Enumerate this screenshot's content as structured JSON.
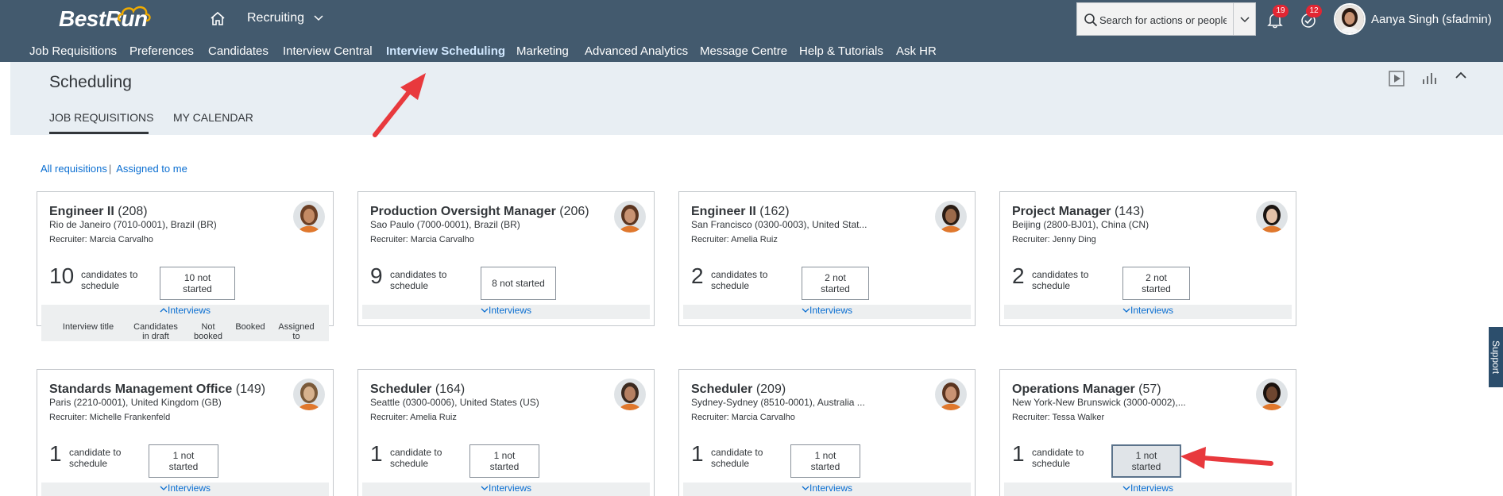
{
  "shell": {
    "logo": "BestRun",
    "module": "Recruiting",
    "search_placeholder": "Search for actions or people",
    "notifications_count": "19",
    "tasks_count": "12",
    "user_name": "Aanya Singh (sfadmin)"
  },
  "nav": [
    "Job Requisitions",
    "Preferences",
    "Candidates",
    "Interview Central",
    "Interview Scheduling",
    "Marketing",
    "Advanced Analytics",
    "Message Centre",
    "Help & Tutorials",
    "Ask HR"
  ],
  "nav_active": "Interview Scheduling",
  "page": {
    "title": "Scheduling",
    "tabs": [
      "JOB REQUISITIONS",
      "MY CALENDAR"
    ],
    "active_tab": "JOB REQUISITIONS"
  },
  "filters": {
    "all": "All requisitions",
    "sep": "|",
    "mine": "Assigned to me"
  },
  "cards": [
    {
      "title": "Engineer II",
      "id": "(208)",
      "location": "Rio de Janeiro (7010-0001), Brazil (BR)",
      "recruiter": "Recruiter: Marcia Carvalho",
      "count": "10",
      "count_label": "candidates to schedule",
      "status": "10 not started",
      "footer": "Interviews",
      "expanded": true,
      "columns": [
        "Interview title",
        "Candidates in draft",
        "Not booked",
        "Booked",
        "Assigned to"
      ]
    },
    {
      "title": "Production Oversight Manager",
      "id": "(206)",
      "location": "Sao Paulo (7000-0001), Brazil (BR)",
      "recruiter": "Recruiter: Marcia Carvalho",
      "count": "9",
      "count_label": "candidates to schedule",
      "status": "8 not started",
      "footer": "Interviews"
    },
    {
      "title": "Engineer II",
      "id": "(162)",
      "location": "San Francisco (0300-0003), United Stat...",
      "recruiter": "Recruiter: Amelia Ruiz",
      "count": "2",
      "count_label": "candidates to schedule",
      "status": "2 not started",
      "footer": "Interviews"
    },
    {
      "title": "Project Manager",
      "id": "(143)",
      "location": "Beijing (2800-BJ01), China (CN)",
      "recruiter": "Recruiter: Jenny Ding",
      "count": "2",
      "count_label": "candidates to schedule",
      "status": "2 not started",
      "footer": "Interviews"
    },
    {
      "title": "Standards Management Office",
      "id": "(149)",
      "location": "Paris (2210-0001), United Kingdom (GB)",
      "recruiter": "Recruiter: Michelle Frankenfeld",
      "count": "1",
      "count_label": "candidate to schedule",
      "status": "1 not started",
      "footer": "Interviews"
    },
    {
      "title": "Scheduler",
      "id": "(164)",
      "location": "Seattle (0300-0006), United States (US)",
      "recruiter": "Recruiter: Amelia Ruiz",
      "count": "1",
      "count_label": "candidate to schedule",
      "status": "1 not started",
      "footer": "Interviews"
    },
    {
      "title": "Scheduler",
      "id": "(209)",
      "location": "Sydney-Sydney (8510-0001), Australia ...",
      "recruiter": "Recruiter: Marcia Carvalho",
      "count": "1",
      "count_label": "candidate to schedule",
      "status": "1 not started",
      "footer": "Interviews"
    },
    {
      "title": "Operations Manager",
      "id": "(57)",
      "location": "New York-New Brunswick (3000-0002),...",
      "recruiter": "Recruiter: Tessa Walker",
      "count": "1",
      "count_label": "candidate to schedule",
      "status": "1 not started",
      "footer": "Interviews",
      "focused": true
    }
  ],
  "support_label": "Support",
  "colors": {
    "shell": "#435a6e",
    "header": "#e8eef3",
    "link": "#0a6ed1",
    "arrow": "#e8393d",
    "badge": "#e22633"
  }
}
